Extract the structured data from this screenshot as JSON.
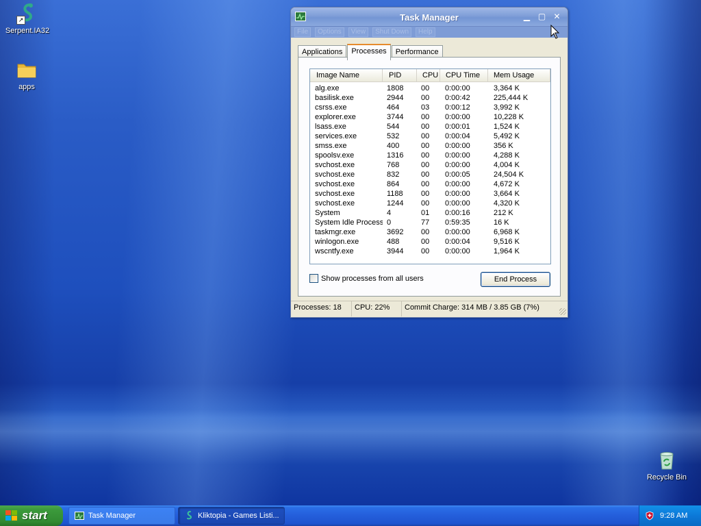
{
  "desktop": {
    "icons": [
      {
        "label": "Serpent.IA32"
      },
      {
        "label": "apps"
      },
      {
        "label": "Recycle Bin"
      }
    ]
  },
  "window": {
    "title": "Task Manager",
    "menu": [
      "File",
      "Options",
      "View",
      "Shut Down",
      "Help"
    ],
    "tabs": [
      "Applications",
      "Processes",
      "Performance"
    ],
    "active_tab": "Processes",
    "columns": [
      "Image Name",
      "PID",
      "CPU",
      "CPU Time",
      "Mem Usage"
    ],
    "processes": [
      [
        "alg.exe",
        "1808",
        "00",
        "0:00:00",
        "3,364 K"
      ],
      [
        "basilisk.exe",
        "2944",
        "00",
        "0:00:42",
        "225,444 K"
      ],
      [
        "csrss.exe",
        "464",
        "03",
        "0:00:12",
        "3,992 K"
      ],
      [
        "explorer.exe",
        "3744",
        "00",
        "0:00:00",
        "10,228 K"
      ],
      [
        "lsass.exe",
        "544",
        "00",
        "0:00:01",
        "1,524 K"
      ],
      [
        "services.exe",
        "532",
        "00",
        "0:00:04",
        "5,492 K"
      ],
      [
        "smss.exe",
        "400",
        "00",
        "0:00:00",
        "356 K"
      ],
      [
        "spoolsv.exe",
        "1316",
        "00",
        "0:00:00",
        "4,288 K"
      ],
      [
        "svchost.exe",
        "768",
        "00",
        "0:00:00",
        "4,004 K"
      ],
      [
        "svchost.exe",
        "832",
        "00",
        "0:00:05",
        "24,504 K"
      ],
      [
        "svchost.exe",
        "864",
        "00",
        "0:00:00",
        "4,672 K"
      ],
      [
        "svchost.exe",
        "1188",
        "00",
        "0:00:00",
        "3,664 K"
      ],
      [
        "svchost.exe",
        "1244",
        "00",
        "0:00:00",
        "4,320 K"
      ],
      [
        "System",
        "4",
        "01",
        "0:00:16",
        "212 K"
      ],
      [
        "System Idle Process",
        "0",
        "77",
        "0:59:35",
        "16 K"
      ],
      [
        "taskmgr.exe",
        "3692",
        "00",
        "0:00:00",
        "6,968 K"
      ],
      [
        "winlogon.exe",
        "488",
        "00",
        "0:00:04",
        "9,516 K"
      ],
      [
        "wscntfy.exe",
        "3944",
        "00",
        "0:00:00",
        "1,964 K"
      ]
    ],
    "show_all_users_label": "Show processes from all users",
    "show_all_users_checked": false,
    "end_process_label": "End Process",
    "status": {
      "processes": "Processes: 18",
      "cpu": "CPU:  22%",
      "commit": "Commit Charge: 314 MB / 3.85 GB (7%)"
    }
  },
  "taskbar": {
    "start_label": "start",
    "buttons": [
      {
        "label": "Task Manager"
      },
      {
        "label": "Kliktopia - Games Listi..."
      }
    ],
    "clock": "9:28 AM"
  },
  "colors": {
    "taskbar_blue": "#245edb",
    "start_green": "#3c9a3c",
    "tray_blue": "#0c79d8",
    "tab_highlight": "#e68b2c"
  }
}
